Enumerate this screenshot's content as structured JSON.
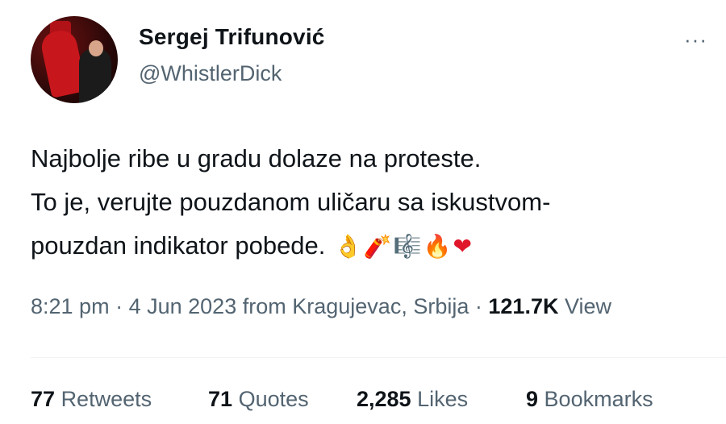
{
  "tweet": {
    "author": {
      "name": "Sergej Trifunović",
      "handle": "@WhistlerDick"
    },
    "more_icon": "···",
    "text_lines": [
      "Najbolje ribe u gradu dolaze na proteste.",
      "To je, verujte pouzdanom uličaru sa iskustvom-",
      "pouzdan indikator pobede."
    ],
    "emojis": [
      {
        "name": "ok-hand-icon",
        "glyph": "👌"
      },
      {
        "name": "firecracker-icon",
        "glyph": "🧨"
      },
      {
        "name": "musical-score-icon",
        "glyph": "🎼"
      },
      {
        "name": "fire-icon",
        "glyph": "🔥"
      },
      {
        "name": "red-heart-icon",
        "glyph": "❤"
      }
    ],
    "meta": {
      "time": "8:21 pm",
      "date": "4 Jun 2023",
      "location_text": "from Kragujevac, Srbija",
      "separator": "·",
      "views_count": "121.7K",
      "views_label": "View"
    },
    "stats": {
      "retweets": {
        "count": "77",
        "label": "Retweets"
      },
      "quotes": {
        "count": "71",
        "label": "Quotes"
      },
      "likes": {
        "count": "2,285",
        "label": "Likes"
      },
      "bookmarks": {
        "count": "9",
        "label": "Bookmarks"
      }
    }
  }
}
